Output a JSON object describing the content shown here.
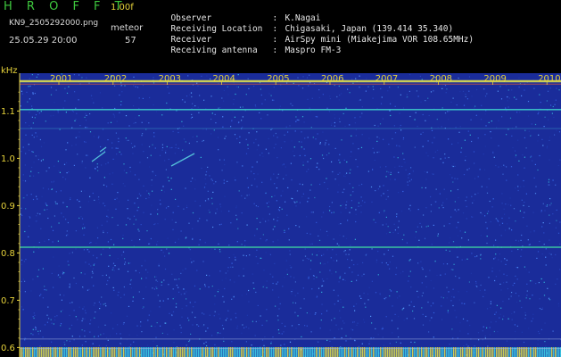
{
  "header": {
    "app_title": "H R O F F T",
    "version": "1.00f",
    "filename": "KN9_2505292000.png",
    "timestamp": "25.05.29 20:00",
    "meteor_label": "meteor",
    "meteor_count": "57"
  },
  "info": [
    {
      "key": "Observer",
      "sep": ":",
      "value": "K.Nagai"
    },
    {
      "key": "Receiving Location",
      "sep": ":",
      "value": "Chigasaki, Japan (139.414 35.340)"
    },
    {
      "key": "Receiver",
      "sep": ":",
      "value": "AirSpy mini (Miakejima VOR 108.65MHz)"
    },
    {
      "key": "Receiving antenna",
      "sep": ":",
      "value": "Maspro FM-3"
    }
  ],
  "axis": {
    "unit_label": "kHz",
    "y_ticks": [
      "1.1",
      "1.0",
      "0.9",
      "0.8",
      "0.7",
      "0.6"
    ],
    "y_tick_values": [
      1.1,
      1.0,
      0.9,
      0.8,
      0.7,
      0.6
    ],
    "y_range": [
      0.58,
      1.18
    ],
    "x_ticks": [
      "2001",
      "2002",
      "2003",
      "2004",
      "2005",
      "2006",
      "2007",
      "2008",
      "2009",
      "2010"
    ]
  },
  "colors": {
    "background": "#1a2c9a",
    "axis_text": "#e6d23a",
    "carrier_line": "#e8e84a",
    "title": "#3ec83e"
  }
}
